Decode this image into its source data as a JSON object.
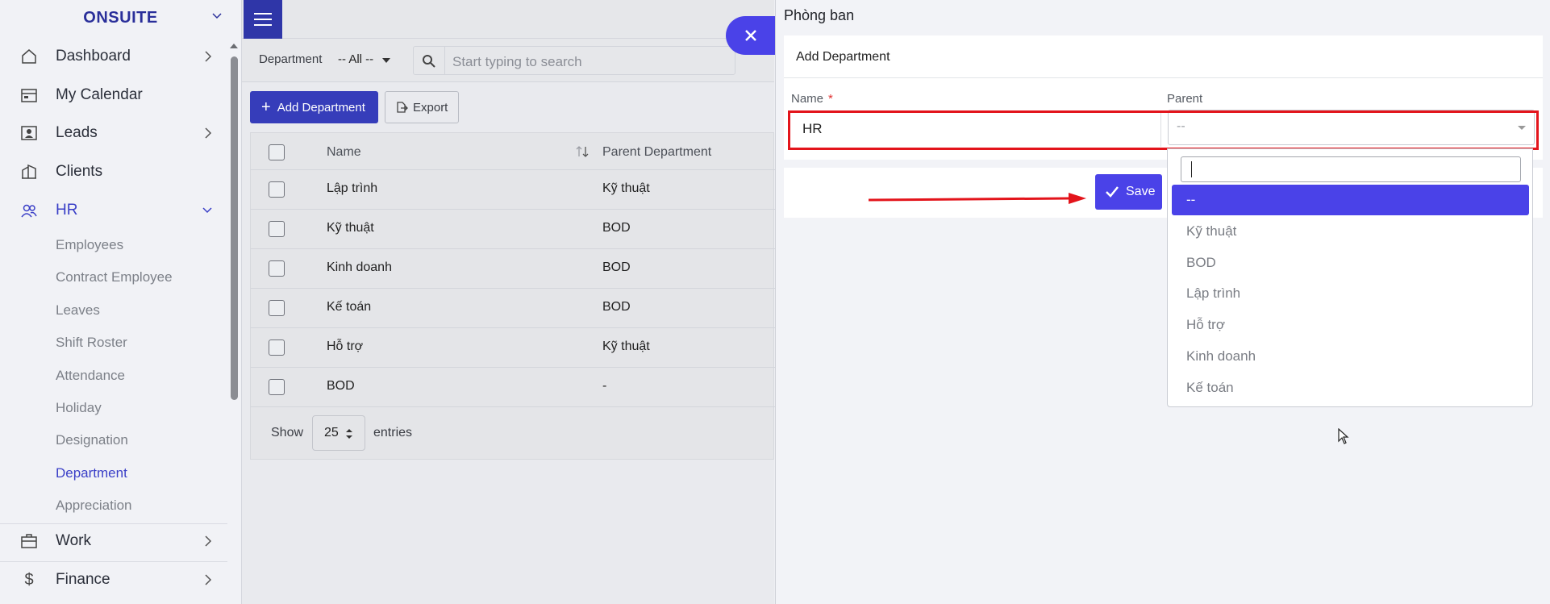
{
  "sidebar": {
    "brand": "ONSUITE",
    "items": [
      {
        "label": "Dashboard"
      },
      {
        "label": "My Calendar"
      },
      {
        "label": "Leads"
      },
      {
        "label": "Clients"
      },
      {
        "label": "HR"
      },
      {
        "label": "Work"
      },
      {
        "label": "Finance"
      }
    ],
    "hr_sub": [
      "Employees",
      "Contract Employee",
      "Leaves",
      "Shift Roster",
      "Attendance",
      "Holiday",
      "Designation",
      "Department",
      "Appreciation"
    ]
  },
  "filter": {
    "label": "Department",
    "value": "-- All --",
    "search_placeholder": "Start typing to search"
  },
  "toolbar": {
    "add_label": "Add Department",
    "export_label": "Export"
  },
  "table": {
    "headers": [
      "Name",
      "Parent Department"
    ],
    "rows": [
      {
        "name": "Lập trình",
        "parent": "Kỹ thuật"
      },
      {
        "name": "Kỹ thuật",
        "parent": "BOD"
      },
      {
        "name": "Kinh doanh",
        "parent": "BOD"
      },
      {
        "name": "Kế toán",
        "parent": "BOD"
      },
      {
        "name": "Hỗ trợ",
        "parent": "Kỹ thuật"
      },
      {
        "name": "BOD",
        "parent": "-"
      }
    ],
    "show_label": "Show",
    "page_size": "25",
    "entries_label": "entries"
  },
  "panel": {
    "title": "Phòng ban",
    "form_title": "Add Department",
    "name_label": "Name",
    "required_mark": "*",
    "name_value": "HR",
    "parent_label": "Parent",
    "parent_value": "--",
    "save_label": "Save",
    "options": [
      "--",
      "Kỹ thuật",
      "BOD",
      "Lập trình",
      "Hỗ trợ",
      "Kinh doanh",
      "Kế toán"
    ]
  },
  "colors": {
    "accent": "#4a42e8",
    "primary_dark": "#363dba",
    "highlight": "#e3141b"
  }
}
